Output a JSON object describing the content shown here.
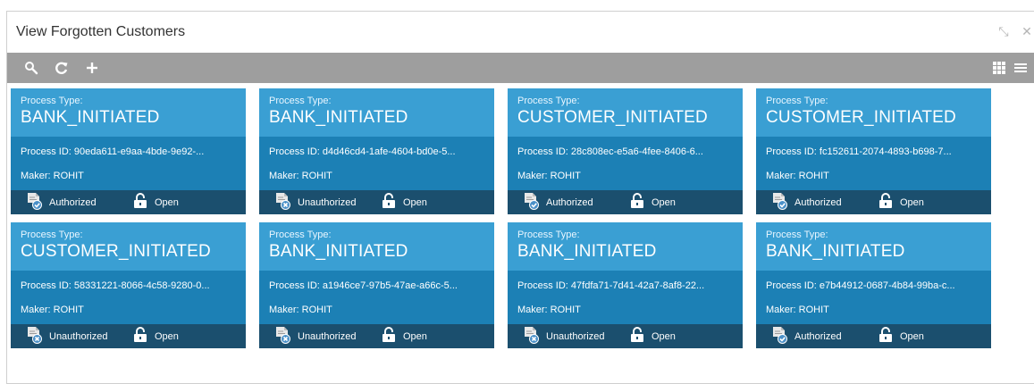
{
  "window": {
    "title": "View Forgotten Customers",
    "controls": [
      {
        "icon": "minimize-icon",
        "glyph": "⤡"
      },
      {
        "icon": "close-icon",
        "glyph": "✕"
      }
    ]
  },
  "toolbar": {
    "left": [
      {
        "icon": "search-icon"
      },
      {
        "icon": "refresh-icon"
      },
      {
        "icon": "add-icon"
      }
    ],
    "right": [
      {
        "icon": "grid-view-icon"
      },
      {
        "icon": "list-view-icon"
      }
    ]
  },
  "colors": {
    "card_top": "#3a9fd3",
    "card_mid": "#1c80b5",
    "card_bottom": "#1b4f6e",
    "toolbar": "#9e9e9e"
  },
  "cards": [
    {
      "label": "Process Type:",
      "type": "BANK_INITIATED",
      "process_id": "Process ID:  90eda611-e9aa-4bde-9e92-...",
      "maker": "Maker:  ROHIT",
      "status": "Authorized",
      "status_icon": "authorized-icon",
      "lock": "Open"
    },
    {
      "label": "Process Type:",
      "type": "BANK_INITIATED",
      "process_id": "Process ID:  d4d46cd4-1afe-4604-bd0e-5...",
      "maker": "Maker:  ROHIT",
      "status": "Unauthorized",
      "status_icon": "unauthorized-icon",
      "lock": "Open"
    },
    {
      "label": "Process Type:",
      "type": "CUSTOMER_INITIATED",
      "process_id": "Process ID:  28c808ec-e5a6-4fee-8406-6...",
      "maker": "Maker:  ROHIT",
      "status": "Authorized",
      "status_icon": "authorized-icon",
      "lock": "Open"
    },
    {
      "label": "Process Type:",
      "type": "CUSTOMER_INITIATED",
      "process_id": "Process ID:  fc152611-2074-4893-b698-7...",
      "maker": "Maker:  ROHIT",
      "status": "Authorized",
      "status_icon": "authorized-icon",
      "lock": "Open"
    },
    {
      "label": "Process Type:",
      "type": "CUSTOMER_INITIATED",
      "process_id": "Process ID:  58331221-8066-4c58-9280-0...",
      "maker": "Maker:  ROHIT",
      "status": "Unauthorized",
      "status_icon": "unauthorized-icon",
      "lock": "Open"
    },
    {
      "label": "Process Type:",
      "type": "BANK_INITIATED",
      "process_id": "Process ID:  a1946ce7-97b5-47ae-a66c-5...",
      "maker": "Maker:  ROHIT",
      "status": "Unauthorized",
      "status_icon": "unauthorized-icon",
      "lock": "Open"
    },
    {
      "label": "Process Type:",
      "type": "BANK_INITIATED",
      "process_id": "Process ID:  47fdfa71-7d41-42a7-8af8-22...",
      "maker": "Maker:  ROHIT",
      "status": "Unauthorized",
      "status_icon": "unauthorized-icon",
      "lock": "Open"
    },
    {
      "label": "Process Type:",
      "type": "BANK_INITIATED",
      "process_id": "Process ID:  e7b44912-0687-4b84-99ba-c...",
      "maker": "Maker:  ROHIT",
      "status": "Authorized",
      "status_icon": "authorized-icon",
      "lock": "Open"
    }
  ]
}
